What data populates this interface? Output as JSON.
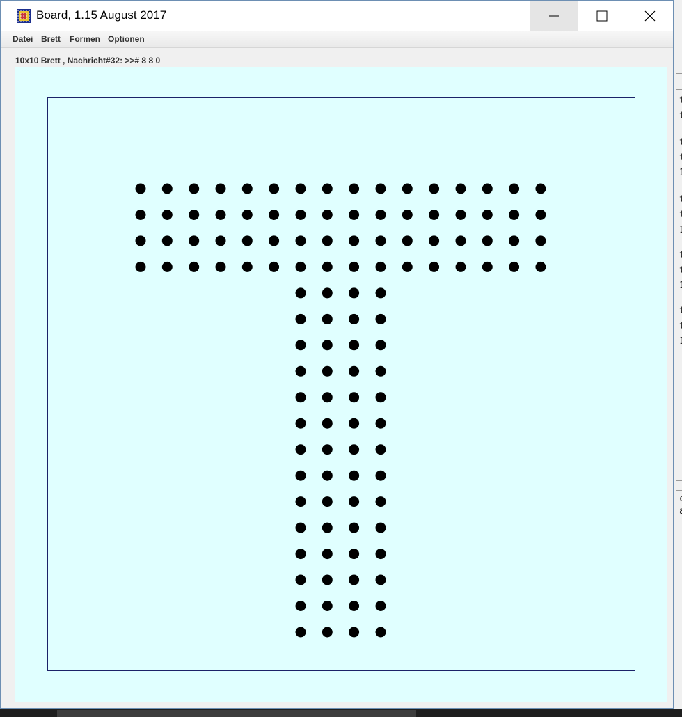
{
  "window": {
    "title": "Board, 1.15 August 2017",
    "controls": [
      "minimize-icon",
      "maximize-icon",
      "close-icon"
    ]
  },
  "menu": {
    "items": [
      "Datei",
      "Brett",
      "Formen",
      "Optionen"
    ]
  },
  "status": {
    "text": "10x10 Brett , Nachricht#32: >># 8 8 0"
  },
  "board": {
    "background": "#e0ffff",
    "frame_color": "#1c2268",
    "dot_color": "#000000",
    "columns": 16,
    "rows": 18,
    "filled_cells": [
      {
        "rows": [
          0,
          3
        ],
        "cols": [
          0,
          15
        ]
      },
      {
        "rows": [
          4,
          17
        ],
        "cols": [
          6,
          9
        ]
      }
    ]
  },
  "background_window": {
    "visible_fragments": [
      "t",
      "t",
      "t",
      "t",
      "1",
      "t",
      "t",
      "1",
      "t",
      "t",
      "1",
      "t",
      "t",
      "1",
      "c",
      "a"
    ]
  }
}
